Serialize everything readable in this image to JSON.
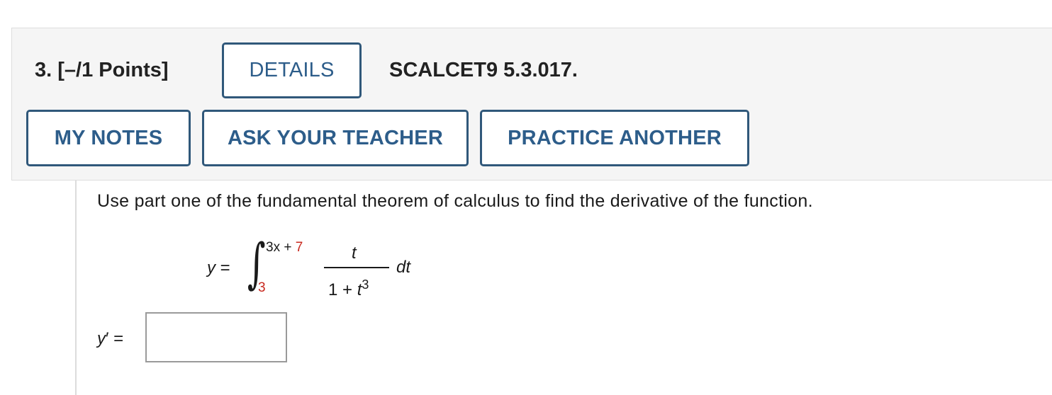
{
  "header": {
    "question_number": "3.",
    "points": "[–/1 Points]",
    "details_label": "DETAILS",
    "reference": "SCALCET9 5.3.017."
  },
  "toolbar": {
    "my_notes_label": "MY NOTES",
    "ask_teacher_label": "ASK YOUR TEACHER",
    "practice_another_label": "PRACTICE ANOTHER"
  },
  "problem": {
    "prompt": "Use part one of the fundamental theorem of calculus to find the derivative of the function.",
    "lhs_var": "y",
    "equals": "=",
    "integral_symbol": "∫",
    "upper_limit_a": "3x + ",
    "upper_limit_b": "7",
    "lower_limit": "3",
    "numerator": "t",
    "denominator_base": "1 + ",
    "denominator_var": "t",
    "denominator_exp": "3",
    "differential": "dt"
  },
  "answer": {
    "label_var": "y",
    "label_prime": "′",
    "label_equals": " =",
    "value": "",
    "placeholder": ""
  },
  "colors": {
    "button_border": "#30587a",
    "button_text": "#2d5d8a",
    "header_bg": "#f5f5f5",
    "highlight_red": "#c8281e"
  }
}
